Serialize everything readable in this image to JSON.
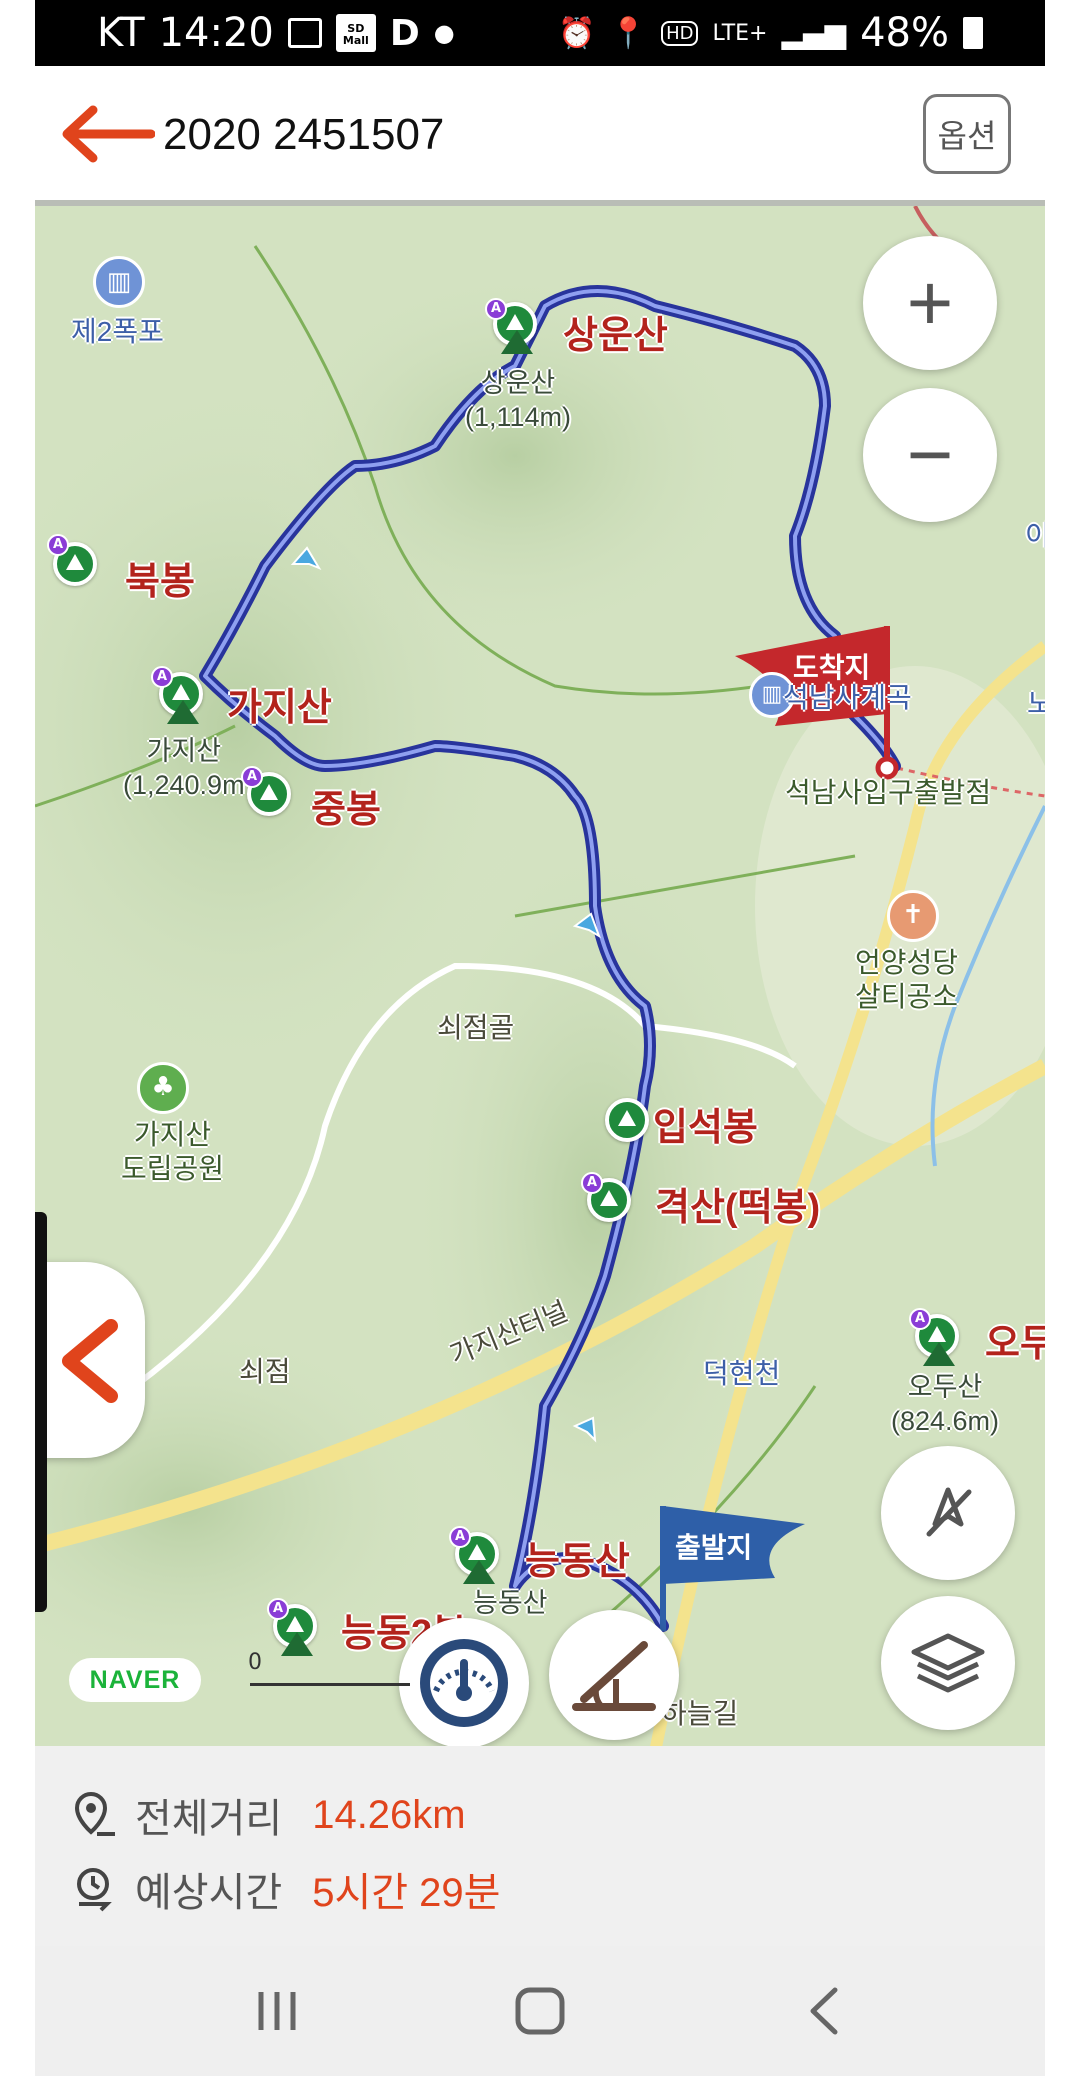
{
  "status_bar": {
    "carrier": "KT",
    "time": "14:20",
    "battery": "48%",
    "network": "LTE+"
  },
  "header": {
    "title": "2020 2451507",
    "back_icon": "back-arrow-icon",
    "options_label": "옵션"
  },
  "map": {
    "peaks": [
      {
        "name": "상운산",
        "sub": "상운산\n(1,114m)"
      },
      {
        "name": "북봉"
      },
      {
        "name": "가지산",
        "sub": "가지산\n(1,240.9m"
      },
      {
        "name": "중봉"
      },
      {
        "name": "입석봉"
      },
      {
        "name": "격산(떡봉)"
      },
      {
        "name": "능동산",
        "sub": "능동산\n(983m)"
      },
      {
        "name": "능동2봉"
      },
      {
        "name": "오두",
        "sub": "오두산\n(824.6m)"
      }
    ],
    "pois": {
      "waterfall": "제2폭포",
      "valley": "석남사계곡",
      "trailhead": "석남사입구출발점",
      "church": "언양성당\n살티공소",
      "village1": "쇠점골",
      "park": "가지산\n도립공원",
      "village2": "쇠점",
      "tunnel": "가지산터널",
      "stream": "덕현천",
      "road": "하늘길",
      "edge_label": "이",
      "edge_label2": "노"
    },
    "flags": {
      "finish": "도착지",
      "start": "출발지"
    },
    "controls": {
      "zoom_in": "+",
      "zoom_out": "−"
    },
    "brand": "NAVER",
    "scale_label": "0",
    "colors": {
      "route": "#3340c8",
      "finish_flag": "#c4282c",
      "start_flag": "#2e5fa8",
      "accent": "#e0441c"
    }
  },
  "summary": {
    "distance_label": "전체거리",
    "distance_value": "14.26km",
    "time_label": "예상시간",
    "time_value": "5시간 29분"
  }
}
